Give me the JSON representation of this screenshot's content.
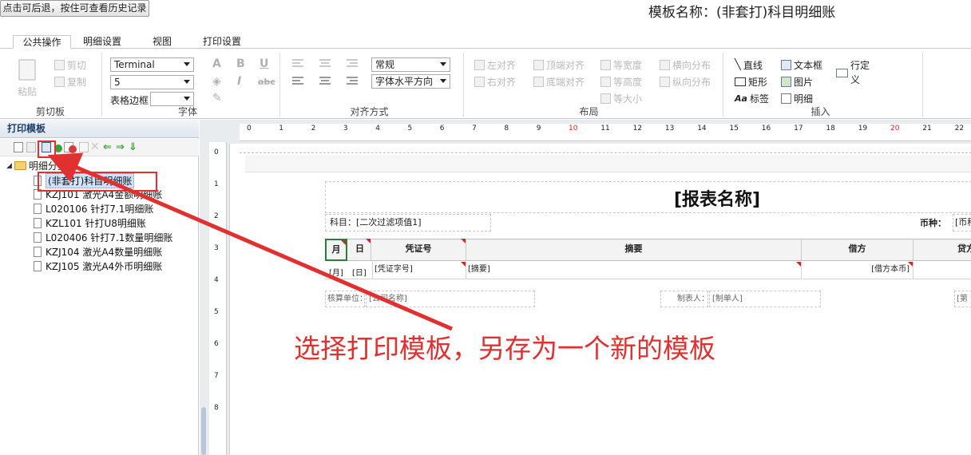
{
  "topbar": {
    "back_button": "点击可后退，按住可查看历史记录",
    "template_title": "模板名称：(非套打)科目明细账"
  },
  "tabs": [
    {
      "label": "公共操作",
      "active": true
    },
    {
      "label": "明细设置",
      "active": false
    },
    {
      "label": "视图",
      "active": false
    },
    {
      "label": "打印设置",
      "active": false
    }
  ],
  "ribbon": {
    "clipboard": {
      "paste": "粘贴",
      "cut": "剪切",
      "copy": "复制",
      "label": "剪切板"
    },
    "font": {
      "family": "Terminal",
      "size": "5",
      "border_label": "表格边框",
      "label": "字体"
    },
    "align": {
      "format": "常规",
      "hpos": "字体水平方向",
      "label": "对齐方式"
    },
    "layout": {
      "items": [
        "左对齐",
        "顶端对齐",
        "等宽度",
        "横向分布",
        "右对齐",
        "底端对齐",
        "等高度",
        "纵向分布",
        "等大小"
      ],
      "label": "布局"
    },
    "insert": {
      "items": [
        "直线",
        "文本框",
        "行定义",
        "矩形",
        "图片",
        "标签",
        "明细"
      ],
      "label": "插入"
    }
  },
  "left_panel": {
    "title": "打印模板",
    "root": "明细分类账",
    "items": [
      "(非套打)科目明细账",
      "KZJ101 激光A4金额明细账",
      "L020106 针打7.1明细账",
      "KZL101 针打U8明细账",
      "L020406 针打7.1数量明细账",
      "KZJ104 激光A4数量明细账",
      "KZJ105 激光A4外币明细账"
    ]
  },
  "rulers": {
    "horizontal": [
      "0",
      "1",
      "2",
      "3",
      "4",
      "5",
      "6",
      "7",
      "8",
      "9",
      "10",
      "11",
      "12",
      "13",
      "14",
      "15",
      "16",
      "17",
      "18",
      "19",
      "20",
      "21",
      "22"
    ],
    "vertical": [
      "0",
      "1",
      "2",
      "3",
      "4",
      "5",
      "6",
      "7",
      "8"
    ]
  },
  "report": {
    "title": "[报表名称]",
    "subject": "科目：[二次过滤项值1]",
    "currency": "币种：",
    "currency_value": "[币种]",
    "headers": [
      "月",
      "日",
      "凭证号",
      "摘要",
      "借方",
      "贷方"
    ],
    "row": [
      "[月]",
      "[日]",
      "[凭证字号]",
      "[摘要]",
      "[借方本币]"
    ],
    "footer": [
      "核算单位：",
      "[公司名称]",
      "制表人：",
      "[制单人]",
      "[第"
    ]
  },
  "annotation": "选择打印模板，另存为一个新的模板",
  "colors": {
    "annotation": "#e03030",
    "highlight_box": "#e03030",
    "red_ruler": "#d4261d"
  }
}
